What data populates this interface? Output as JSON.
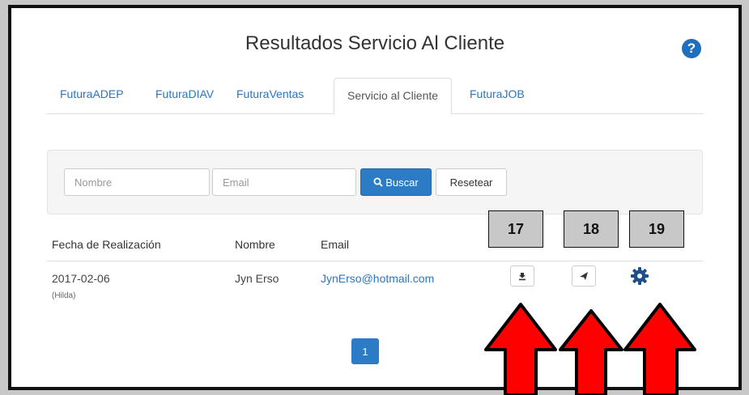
{
  "page": {
    "title": "Resultados Servicio Al Cliente",
    "help_glyph": "?"
  },
  "tabs": [
    {
      "label": "FuturaADEP"
    },
    {
      "label": "FuturaDIAV"
    },
    {
      "label": "FuturaVentas"
    },
    {
      "label": "Servicio al Cliente",
      "active": true
    },
    {
      "label": "FuturaJOB"
    }
  ],
  "filter": {
    "nombre_placeholder": "Nombre",
    "email_placeholder": "Email",
    "search_label": "Buscar",
    "reset_label": "Resetear"
  },
  "table": {
    "headers": [
      "Fecha de Realización",
      "Nombre",
      "Email"
    ],
    "rows": [
      {
        "fecha": "2017-02-06",
        "sub": "(Hilda)",
        "nombre": "Jyn Erso",
        "email": "JynErso@hotmail.com"
      }
    ]
  },
  "annotations": {
    "labels": [
      "17",
      "18",
      "19"
    ],
    "arrow_color": "#ff0000"
  },
  "pagination": {
    "current": "1"
  },
  "icons": {
    "download": "download-icon",
    "send": "send-icon",
    "settings": "gear-icon",
    "help": "help-icon",
    "search": "search-icon"
  },
  "colors": {
    "accent": "#2b7cc4",
    "link": "#2a76c2"
  }
}
